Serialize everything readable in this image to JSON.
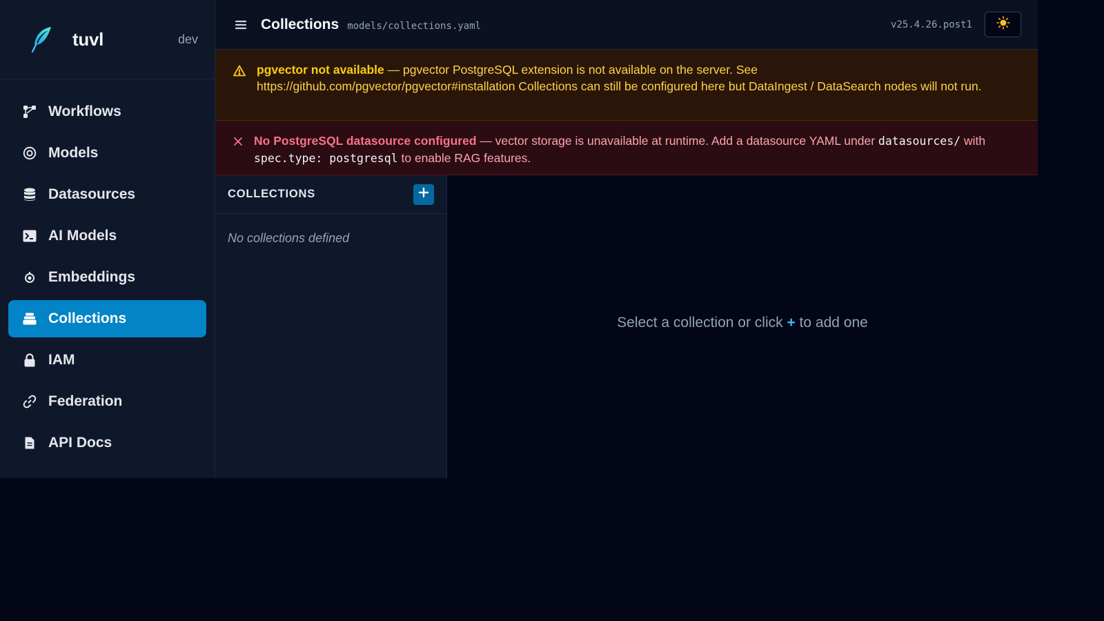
{
  "brand": {
    "name": "tuvl",
    "env": "dev"
  },
  "sidebar": {
    "items": [
      {
        "label": "Workflows",
        "icon": "workflow-icon",
        "active": false
      },
      {
        "label": "Models",
        "icon": "target-icon",
        "active": false
      },
      {
        "label": "Datasources",
        "icon": "database-icon",
        "active": false
      },
      {
        "label": "AI Models",
        "icon": "terminal-icon",
        "active": false
      },
      {
        "label": "Embeddings",
        "icon": "dot-circle-icon",
        "active": false
      },
      {
        "label": "Collections",
        "icon": "layers-icon",
        "active": true
      },
      {
        "label": "IAM",
        "icon": "lock-icon",
        "active": false
      },
      {
        "label": "Federation",
        "icon": "link-icon",
        "active": false
      },
      {
        "label": "API Docs",
        "icon": "document-icon",
        "active": false
      }
    ]
  },
  "header": {
    "title": "Collections",
    "path": "models/collections.yaml",
    "version": "v25.4.26.post1",
    "theme_icon": "sun-icon"
  },
  "alerts": {
    "warning": {
      "title": "pgvector not available",
      "dash": " — ",
      "message": "pgvector PostgreSQL extension is not available on the server. See https://github.com/pgvector/pgvector#installation Collections can still be configured here but DataIngest / DataSearch nodes will not run."
    },
    "error": {
      "title": "No PostgreSQL datasource configured",
      "dash": " — ",
      "message_part1": "vector storage is unavailable at runtime. Add a datasource YAML under ",
      "code1": "datasources/",
      "message_part2": " with ",
      "code2": "spec.type: postgresql",
      "message_part3": " to enable RAG features."
    }
  },
  "collections_panel": {
    "title": "COLLECTIONS",
    "empty_text": "No collections defined"
  },
  "detail": {
    "hint_before": "Select a collection or click ",
    "hint_plus": "+",
    "hint_after": " to add one"
  },
  "colors": {
    "accent": "#0284c7",
    "warning": "#facc15",
    "error": "#fb7185",
    "sidebar_bg": "#0f172a",
    "page_bg": "#020617"
  }
}
